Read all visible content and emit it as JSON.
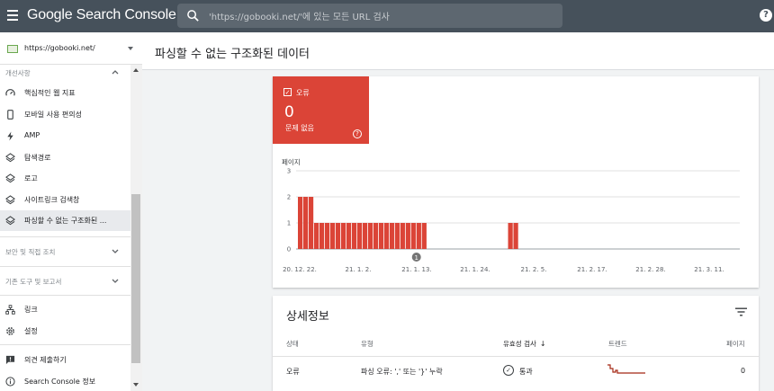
{
  "app": {
    "logo": "Google Search Console",
    "search_placeholder": "'https://gobooki.net/'에 있는 모든 URL 검사",
    "help_glyph": "?"
  },
  "sidebar": {
    "property": "https://gobooki.net/",
    "section_improvements": "개선사항",
    "items": [
      {
        "label": "핵심적인 웹 지표",
        "icon": "speed-gauge-icon"
      },
      {
        "label": "모바일 사용 편의성",
        "icon": "smartphone-icon"
      },
      {
        "label": "AMP",
        "icon": "amp-bolt-icon"
      },
      {
        "label": "탐색경로",
        "icon": "layers-icon"
      },
      {
        "label": "로고",
        "icon": "layers-icon"
      },
      {
        "label": "사이트링크 검색창",
        "icon": "layers-icon"
      },
      {
        "label": "파싱할 수 없는 구조화된 ...",
        "icon": "layers-icon"
      }
    ],
    "section_security": "보안 및 직접 조치",
    "section_legacy": "기존 도구 및 보고서",
    "bottom_items": [
      {
        "label": "링크",
        "icon": "links-icon"
      },
      {
        "label": "설정",
        "icon": "gear-icon"
      },
      {
        "label": "의견 제출하기",
        "icon": "feedback-icon"
      },
      {
        "label": "Search Console 정보",
        "icon": "info-icon"
      }
    ]
  },
  "page": {
    "title": "파싱할 수 없는 구조화된 데이터"
  },
  "summary": {
    "error_label": "오류",
    "error_count": "0",
    "error_sub": "문제 없음",
    "help_glyph": "?",
    "error_color": "#db4437"
  },
  "chart_data": {
    "type": "bar",
    "ylabel": "페이지",
    "ylim": [
      0,
      3
    ],
    "yticks": [
      "0",
      "1",
      "2",
      "3"
    ],
    "xticks": [
      "20. 12. 22.",
      "21. 1. 2.",
      "21. 1. 13.",
      "21. 1. 24.",
      "21. 2. 5.",
      "21. 2. 17.",
      "21. 2. 28.",
      "21. 3. 11."
    ],
    "annotation": "1",
    "bar_color": "#db4437",
    "values": [
      2,
      2,
      2,
      1,
      1,
      1,
      1,
      1,
      1,
      1,
      1,
      1,
      1,
      1,
      1,
      1,
      1,
      1,
      1,
      1,
      1,
      1,
      1,
      1,
      0,
      0,
      0,
      0,
      0,
      0,
      0,
      0,
      0,
      0,
      0,
      0,
      0,
      0,
      0,
      1,
      1,
      0,
      0,
      0,
      0,
      0,
      0,
      0,
      0,
      0,
      0,
      0,
      0,
      0,
      0,
      0,
      0,
      0,
      0,
      0,
      0,
      0,
      0,
      0,
      0,
      0,
      0,
      0,
      0,
      0,
      0,
      0,
      0,
      0,
      0,
      0,
      0,
      0,
      0,
      0,
      0,
      0
    ]
  },
  "details": {
    "title": "상세정보",
    "columns": [
      "상태",
      "유형",
      "유효성 검사",
      "트렌드",
      "페이지"
    ],
    "sort_arrow": "↓",
    "rows": [
      {
        "status": "오류",
        "type": "파싱 오류: ',' 또는 '}' 누락",
        "validation": "통과",
        "pages": "0"
      }
    ],
    "trend_color": "#a52714"
  }
}
